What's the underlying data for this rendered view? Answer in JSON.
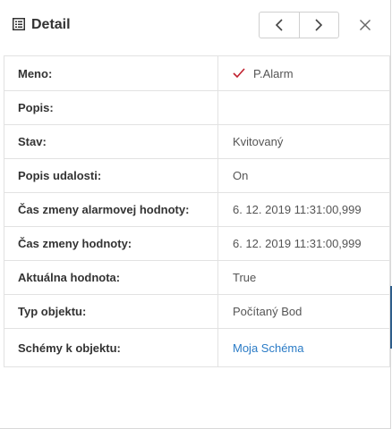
{
  "header": {
    "title": "Detail",
    "icons": {
      "title": "list-detail-icon",
      "prev": "chevron-left-icon",
      "next": "chevron-right-icon",
      "close": "close-icon"
    }
  },
  "colors": {
    "check": "#c0202e",
    "link": "#2a7bc6"
  },
  "rows": [
    {
      "label": "Meno:",
      "value": "P.Alarm",
      "icon": "check-icon"
    },
    {
      "label": "Popis:",
      "value": ""
    },
    {
      "label": "Stav:",
      "value": "Kvitovaný"
    },
    {
      "label": "Popis udalosti:",
      "value": "On"
    },
    {
      "label": "Čas zmeny alarmovej hodnoty:",
      "value": "6. 12. 2019 11:31:00,999"
    },
    {
      "label": "Čas zmeny hodnoty:",
      "value": "6. 12. 2019 11:31:00,999"
    },
    {
      "label": "Aktuálna hodnota:",
      "value": "True"
    },
    {
      "label": "Typ objektu:",
      "value": "Počítaný Bod"
    },
    {
      "label": "Schémy k objektu:",
      "value": "Moja Schéma",
      "link": true
    }
  ]
}
